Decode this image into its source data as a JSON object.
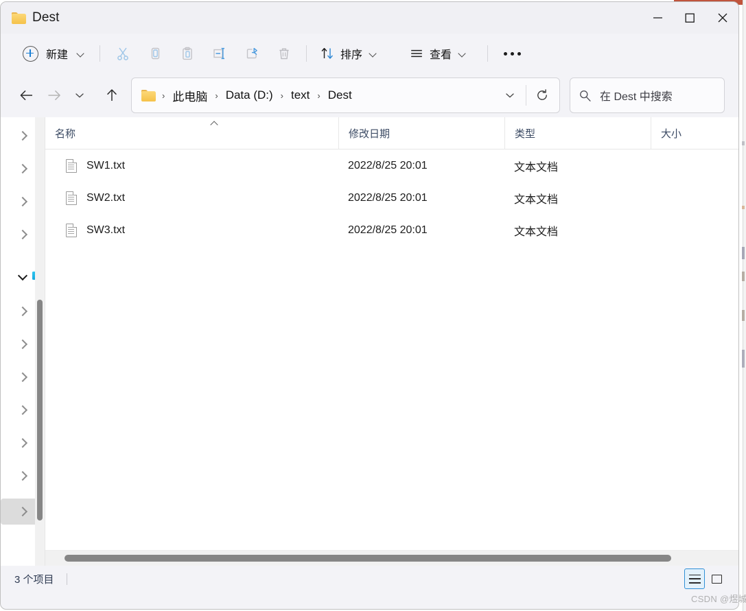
{
  "window": {
    "title": "Dest",
    "folder_icon": "folder-icon",
    "controls": {
      "minimize": "minimize-icon",
      "maximize": "maximize-icon",
      "close": "close-icon"
    }
  },
  "toolbar": {
    "new_label": "新建",
    "new_icon": "plus-circle-icon",
    "new_chevron": "chevron-down-icon",
    "cut_icon": "scissors-icon",
    "copy_icon": "copy-icon",
    "paste_icon": "clipboard-icon",
    "rename_icon": "rename-icon",
    "share_icon": "share-icon",
    "delete_icon": "trash-icon",
    "sort_label": "排序",
    "sort_icon": "sort-arrows-icon",
    "view_label": "查看",
    "view_icon": "list-lines-icon",
    "more_icon": "ellipsis-icon"
  },
  "address": {
    "back_icon": "arrow-left-icon",
    "forward_icon": "arrow-right-icon",
    "recent_icon": "chevron-down-icon",
    "up_icon": "arrow-up-icon",
    "folder_icon": "folder-icon",
    "breadcrumbs": [
      {
        "label": "此电脑"
      },
      {
        "label": "Data (D:)"
      },
      {
        "label": "text"
      },
      {
        "label": "Dest"
      }
    ],
    "separator": "›",
    "dropdown_icon": "chevron-down-icon",
    "refresh_icon": "refresh-icon"
  },
  "search": {
    "icon": "search-icon",
    "placeholder": "在 Dest 中搜索"
  },
  "nav_pane": {
    "items": [
      {
        "icon": "chevron-right-icon",
        "expanded": false,
        "selected": false
      },
      {
        "icon": "chevron-right-icon",
        "expanded": false,
        "selected": false
      },
      {
        "icon": "chevron-right-icon",
        "expanded": false,
        "selected": false
      },
      {
        "icon": "chevron-right-icon",
        "expanded": false,
        "selected": false
      },
      {
        "icon": "chevron-down-icon",
        "expanded": true,
        "selected": false,
        "pc_icon": "this-pc-icon"
      },
      {
        "icon": "chevron-right-icon",
        "expanded": false,
        "selected": false
      },
      {
        "icon": "chevron-right-icon",
        "expanded": false,
        "selected": false
      },
      {
        "icon": "chevron-right-icon",
        "expanded": false,
        "selected": false
      },
      {
        "icon": "chevron-right-icon",
        "expanded": false,
        "selected": false
      },
      {
        "icon": "chevron-right-icon",
        "expanded": false,
        "selected": false
      },
      {
        "icon": "chevron-right-icon",
        "expanded": false,
        "selected": true
      }
    ]
  },
  "file_list": {
    "columns": [
      {
        "key": "name",
        "label": "名称",
        "sorted": "asc"
      },
      {
        "key": "date",
        "label": "修改日期",
        "sorted": ""
      },
      {
        "key": "type",
        "label": "类型",
        "sorted": ""
      },
      {
        "key": "size",
        "label": "大小",
        "sorted": ""
      }
    ],
    "rows": [
      {
        "icon": "text-file-icon",
        "name": "SW1.txt",
        "date": "2022/8/25 20:01",
        "type": "文本文档",
        "size": ""
      },
      {
        "icon": "text-file-icon",
        "name": "SW2.txt",
        "date": "2022/8/25 20:01",
        "type": "文本文档",
        "size": ""
      },
      {
        "icon": "text-file-icon",
        "name": "SW3.txt",
        "date": "2022/8/25 20:01",
        "type": "文本文档",
        "size": ""
      }
    ]
  },
  "status_bar": {
    "item_count_text": "3 个项目",
    "details_view_icon": "details-view-icon",
    "large_icons_view_icon": "large-icons-view-icon",
    "active_view": "details"
  },
  "watermark": {
    "text": "CSDN @煜城"
  },
  "colors": {
    "accent": "#1b7fd4",
    "selection": "#e3f1fb",
    "selection_border": "#2f8fd6",
    "folder": "#f5c249",
    "scrollbar_thumb": "#868686",
    "window_bg": "#f3f3f7",
    "content_bg": "#ffffff",
    "header_text": "#3b4a63",
    "behind_window_strip": "#c0543c"
  }
}
